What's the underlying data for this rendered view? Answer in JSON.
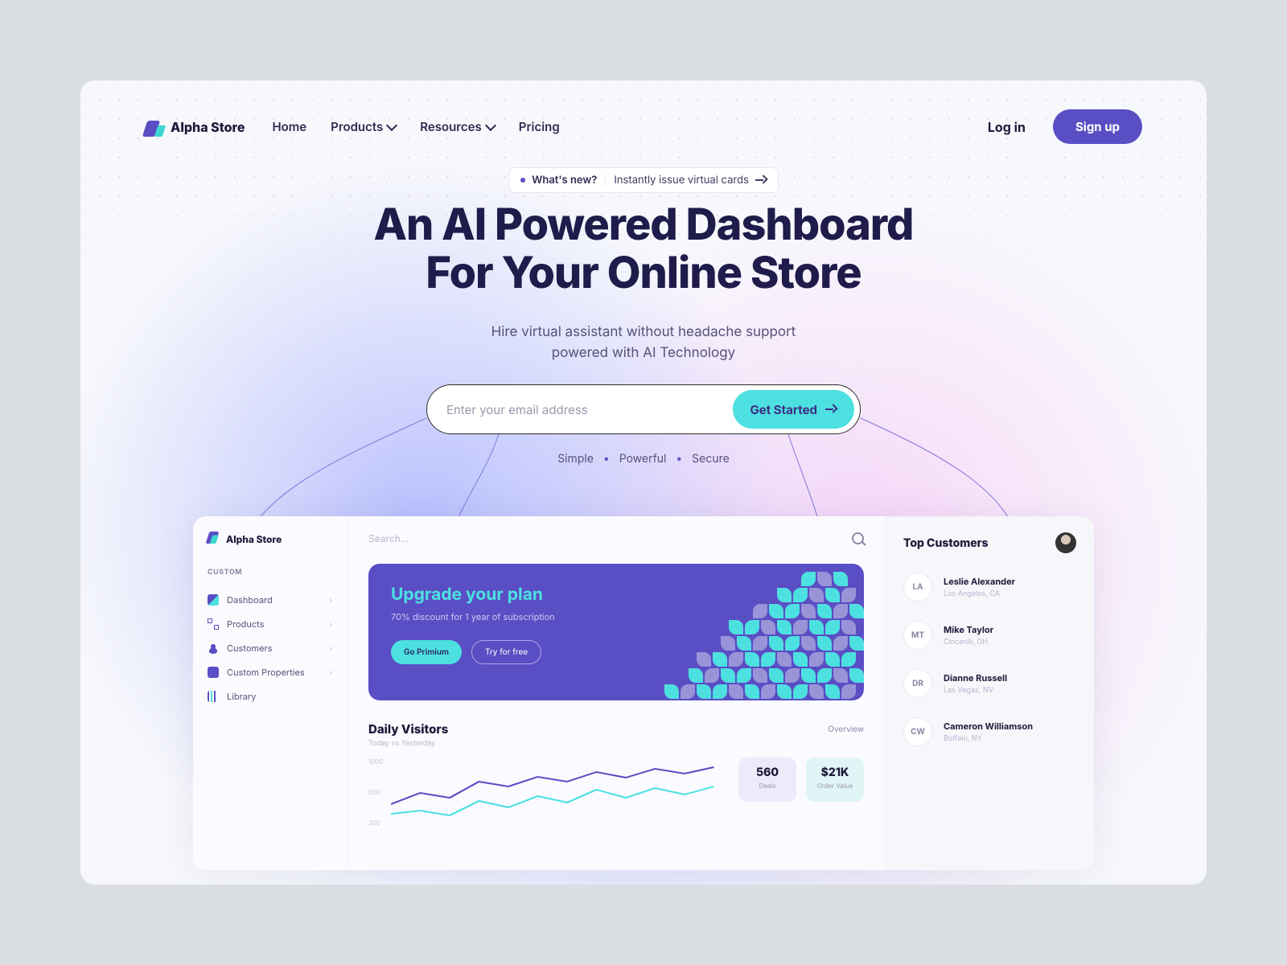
{
  "brand": "Alpha Store",
  "nav": {
    "home": "Home",
    "products": "Products",
    "resources": "Resources",
    "pricing": "Pricing",
    "login": "Log in",
    "signup": "Sign up"
  },
  "pill": {
    "left": "What's new?",
    "right": "Instantly issue virtual cards"
  },
  "hero": {
    "title_l1": "An AI Powered Dashboard",
    "title_l2": "For Your Online Store",
    "sub_l1": "Hire virtual assistant without headache support",
    "sub_l2": "powered with AI Technology"
  },
  "email": {
    "placeholder": "Enter your email address",
    "cta": "Get Started"
  },
  "features": {
    "a": "Simple",
    "b": "Powerful",
    "c": "Secure"
  },
  "dash": {
    "brand": "Alpha Store",
    "section": "CUSTOM",
    "side": [
      {
        "label": "Dashboard"
      },
      {
        "label": "Products"
      },
      {
        "label": "Customers"
      },
      {
        "label": "Custom Properties"
      },
      {
        "label": "Library"
      }
    ],
    "search": "Search...",
    "upgrade": {
      "title": "Upgrade your plan",
      "sub": "70% discount for 1 year of subscription",
      "prim": "Go Primium",
      "sec": "Try for free"
    },
    "daily": {
      "title": "Daily Visitors",
      "sub": "Today vs Yesterday",
      "overview": "Overview",
      "yticks": [
        "1000",
        "600",
        "200"
      ]
    },
    "metrics": [
      {
        "value": "560",
        "label": "Deals"
      },
      {
        "value": "$21K",
        "label": "Order Value"
      }
    ],
    "right": {
      "title": "Top Customers",
      "list": [
        {
          "initials": "LA",
          "name": "Leslie Alexander",
          "loc": "Los Angeles, CA"
        },
        {
          "initials": "MT",
          "name": "Mike Taylor",
          "loc": "Cincenili, OH"
        },
        {
          "initials": "DR",
          "name": "Dianne Russell",
          "loc": "Las Vegas, NV"
        },
        {
          "initials": "CW",
          "name": "Cameron Williamson",
          "loc": "Buffalo, NY"
        }
      ]
    }
  },
  "chart_data": {
    "type": "line",
    "title": "Daily Visitors",
    "ylabel": "",
    "xlabel": "",
    "ylim": [
      0,
      1000
    ],
    "x": [
      0,
      1,
      2,
      3,
      4,
      5,
      6,
      7,
      8,
      9,
      10,
      11
    ],
    "series": [
      {
        "name": "Today",
        "values": [
          420,
          560,
          500,
          700,
          640,
          760,
          700,
          820,
          750,
          860,
          800,
          880
        ]
      },
      {
        "name": "Yesterday",
        "values": [
          300,
          340,
          280,
          460,
          380,
          520,
          440,
          600,
          500,
          620,
          540,
          640
        ]
      }
    ]
  }
}
